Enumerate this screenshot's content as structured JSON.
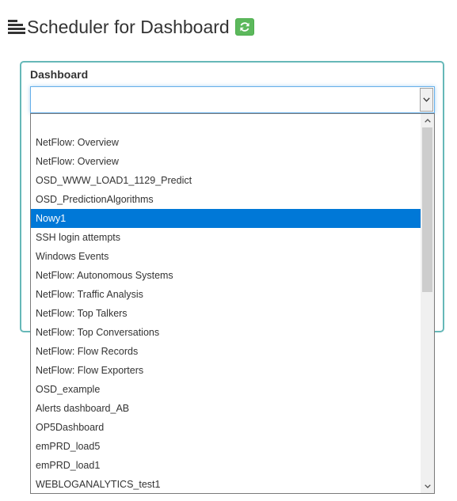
{
  "header": {
    "title": "Scheduler for Dashboard",
    "menu_icon": "hamburger-menu-icon",
    "refresh_icon": "refresh-icon",
    "refresh_color": "#5cb85c"
  },
  "form": {
    "dashboard_label": "Dashboard",
    "dashboard_value": "",
    "panel_border_color": "#66b8b8"
  },
  "dropdown": {
    "selected_index": 5,
    "selected_color": "#0078d7",
    "options": [
      "",
      "NetFlow: Overview",
      "NetFlow: Overview",
      "OSD_WWW_LOAD1_1129_Predict",
      "OSD_PredictionAlgorithms",
      "Nowy1",
      "SSH login attempts",
      "Windows Events",
      "NetFlow: Autonomous Systems",
      "NetFlow: Traffic Analysis",
      "NetFlow: Top Talkers",
      "NetFlow: Top Conversations",
      "NetFlow: Flow Records",
      "NetFlow: Flow Exporters",
      "OSD_example",
      "Alerts dashboard_AB",
      "OP5Dashboard",
      "emPRD_load5",
      "emPRD_load1",
      "WEBLOGANALYTICS_test1"
    ]
  }
}
